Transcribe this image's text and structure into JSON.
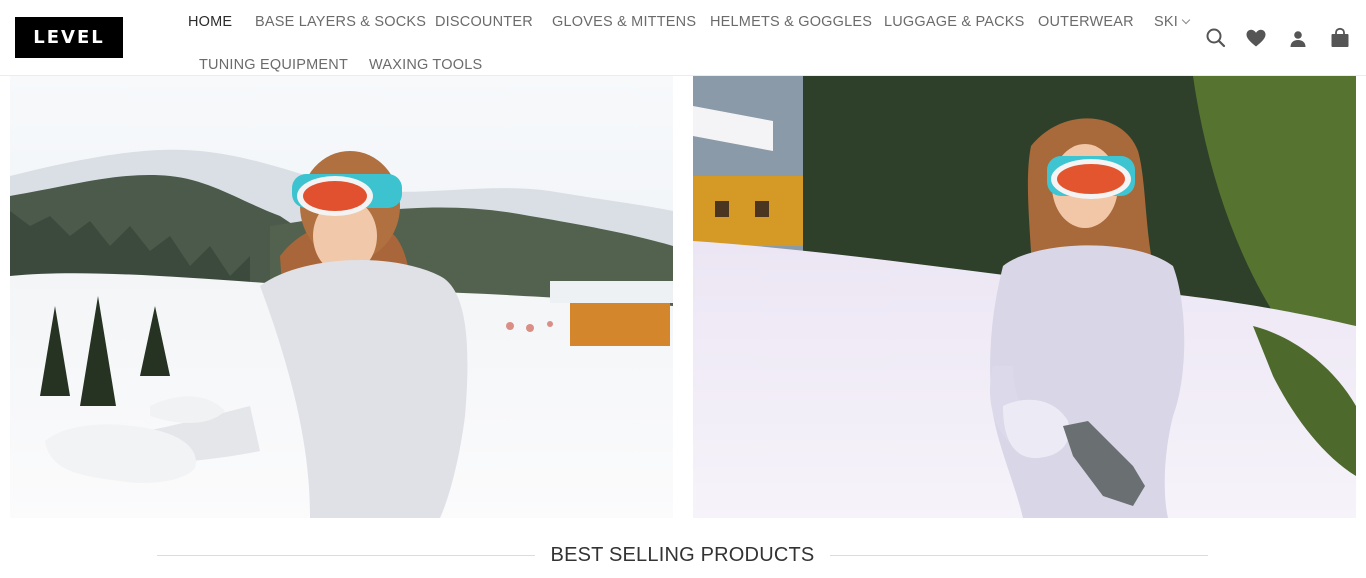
{
  "brand": {
    "logo_text": "LEVEL"
  },
  "nav": {
    "items": [
      {
        "label": "HOME",
        "active": true
      },
      {
        "label": "BASE LAYERS & SOCKS"
      },
      {
        "label": "DISCOUNTER"
      },
      {
        "label": "GLOVES & MITTENS"
      },
      {
        "label": "HELMETS & GOGGLES"
      },
      {
        "label": "LUGGAGE & PACKS"
      },
      {
        "label": "OUTERWEAR"
      },
      {
        "label": "SKI",
        "has_dropdown": true
      },
      {
        "label": "TUNING EQUIPMENT"
      },
      {
        "label": "WAXING TOOLS"
      }
    ]
  },
  "header_icons": [
    "search-icon",
    "heart-icon",
    "user-icon",
    "shopping-bag-icon"
  ],
  "banners": [
    {
      "name": "banner-left",
      "subject": "woman-in-ski-goggles-putting-on-gloves"
    },
    {
      "name": "banner-right",
      "subject": "woman-in-ski-goggles-adjusting-glove"
    }
  ],
  "section": {
    "title": "BEST SELLING PRODUCTS"
  },
  "colors": {
    "text_dark": "#2b2b2b",
    "text_nav": "#6b6b6b",
    "logo_bg": "#000000",
    "divider": "#dcdcdc"
  }
}
